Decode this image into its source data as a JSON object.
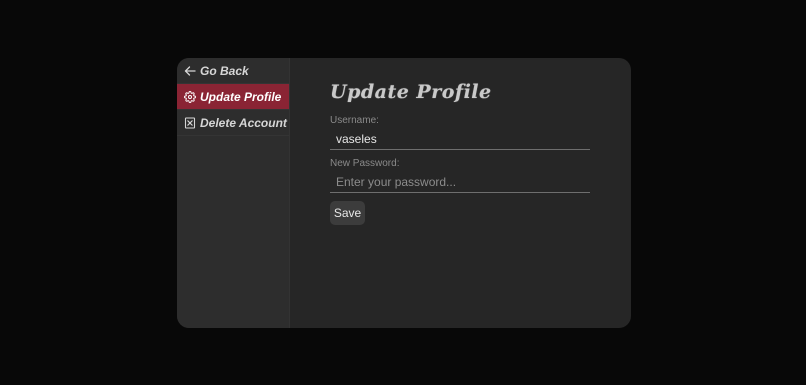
{
  "sidebar": {
    "items": [
      {
        "label": "Go Back",
        "icon": "arrow-left-icon",
        "active": false
      },
      {
        "label": "Update Profile",
        "icon": "gear-icon",
        "active": true
      },
      {
        "label": "Delete Account",
        "icon": "x-square-icon",
        "active": false
      }
    ]
  },
  "main": {
    "title": "Update Profile",
    "username": {
      "label": "Username:",
      "value": "vaseles"
    },
    "password": {
      "label": "New Password:",
      "placeholder": "Enter your password..."
    },
    "save_label": "Save"
  },
  "colors": {
    "page_background": "#080808",
    "card_background": "#262626",
    "sidebar_background": "#2d2d2d",
    "active_accent": "#8a2434",
    "button_background": "#3c3c3c"
  }
}
